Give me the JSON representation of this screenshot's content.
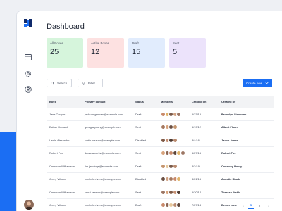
{
  "page": {
    "title": "Dashboard"
  },
  "sidebar": {
    "items": [
      {
        "icon": "logo-icon"
      },
      {
        "icon": "dashboard-icon"
      },
      {
        "icon": "gear-icon"
      },
      {
        "icon": "user-circle-icon"
      }
    ]
  },
  "cards": [
    {
      "label": "All Boxes",
      "value": "25",
      "color": "#d6f5dc"
    },
    {
      "label": "Active Boxes",
      "value": "12",
      "color": "#fde1e1"
    },
    {
      "label": "Draft",
      "value": "15",
      "color": "#e1ecfd"
    },
    {
      "label": "Sent",
      "value": "5",
      "color": "#ece3fb"
    }
  ],
  "toolbar": {
    "search_label": "Search",
    "filter_label": "Filter",
    "create_label": "Create new"
  },
  "table": {
    "columns": [
      "Boss",
      "Primary contact",
      "Status",
      "Members",
      "Created on",
      "Created by"
    ],
    "rows": [
      {
        "boss": "Jane Cooper",
        "contact": "jackson.graham@example.com",
        "status": "Draft",
        "created_on": "5/27/15",
        "created_by": "Brooklyn Simmons",
        "members": [
          "#c98a6b",
          "#e0b36a",
          "#7a5a4a",
          "#d1a384",
          "#9c7664"
        ]
      },
      {
        "boss": "Esther Howard",
        "contact": "georgia.young@example.com",
        "status": "Sent",
        "created_on": "5/19/12",
        "created_by": "Albert Flores",
        "members": [
          "#a5785f",
          "#d8a37c",
          "#6a4f43",
          "#c4956f"
        ]
      },
      {
        "boss": "Leslie Alexander",
        "contact": "curtis.weaver@example.com",
        "status": "Disabled",
        "created_on": "3/4/16",
        "created_by": "Jacob Jones",
        "members": [
          "#7f5a47",
          "#c69175",
          "#4e3a31",
          "#b98a6f"
        ]
      },
      {
        "boss": "Robert Fox",
        "contact": "deanna.curtis@example.com",
        "status": "Sent",
        "created_on": "5/27/15",
        "created_by": "Robert Fox",
        "members": [
          "#d8a37c",
          "#8a6452",
          "#c98a6b",
          "#5c4438",
          "#e0b36a",
          "#9c7664"
        ]
      },
      {
        "boss": "Cameron Williamson",
        "contact": "tim.jennings@example.com",
        "status": "Draft",
        "created_on": "8/2/19",
        "created_by": "Courtney Henry",
        "members": [
          "#c4956f",
          "#e7c79a",
          "#7a5a4a",
          "#b98a6f"
        ]
      },
      {
        "boss": "Jenny Wilson",
        "contact": "michelle.rivera@example.com",
        "status": "Disabled",
        "created_on": "8/21/15",
        "created_by": "Annette Black",
        "members": [
          "#6a4f43",
          "#d1a384",
          "#a5785f",
          "#c98a6b",
          "#e0b36a"
        ]
      },
      {
        "boss": "Cameron Williamson",
        "contact": "kenzi.lawson@example.com",
        "status": "Sent",
        "created_on": "5/30/14",
        "created_by": "Theresa Webb",
        "members": [
          "#9c7664",
          "#d8a37c",
          "#7f5a47",
          "#c69175",
          "#4e3a31"
        ]
      },
      {
        "boss": "Jenny Wilson",
        "contact": "michelle.rivera@example.com",
        "status": "Draft",
        "created_on": "7/27/13",
        "created_by": "Devon Lane",
        "members": [
          "#c98a6b",
          "#8a6452",
          "#e7c79a",
          "#b98a6f",
          "#5c4438"
        ]
      }
    ]
  },
  "pagination": {
    "prev": "‹",
    "pages": [
      "1",
      "2"
    ],
    "active": "1",
    "next": "›"
  },
  "colors": {
    "accent": "#1b6ef3"
  }
}
